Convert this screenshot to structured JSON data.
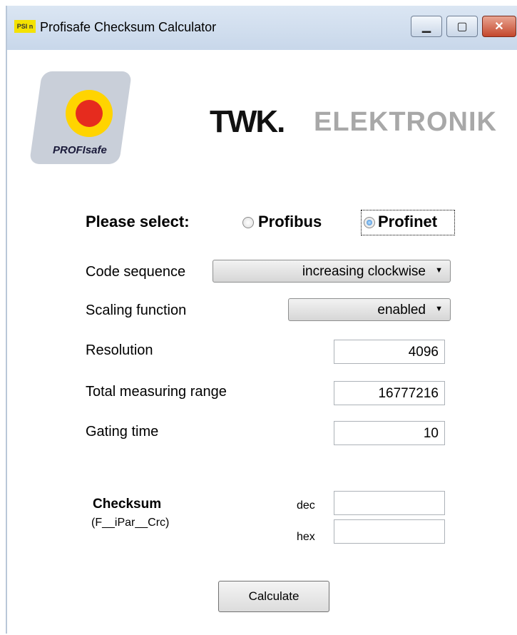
{
  "window": {
    "title": "Profisafe Checksum Calculator",
    "icon_text": "PSI n"
  },
  "logos": {
    "profisafe": "PROFIsafe",
    "twk": "TWK.",
    "elektronik": "ELEKTRONIK"
  },
  "protocol": {
    "label": "Please select:",
    "options": [
      "Profibus",
      "Profinet"
    ],
    "selected": "Profinet"
  },
  "form": {
    "code_sequence": {
      "label": "Code sequence",
      "value": "increasing clockwise"
    },
    "scaling_function": {
      "label": "Scaling function",
      "value": "enabled"
    },
    "resolution": {
      "label": "Resolution",
      "value": "4096"
    },
    "total_range": {
      "label": "Total measuring range",
      "value": "16777216"
    },
    "gating_time": {
      "label": "Gating time",
      "value": "10"
    }
  },
  "checksum": {
    "title": "Checksum",
    "subtitle": "(F__iPar__Crc)",
    "dec_label": "dec",
    "hex_label": "hex",
    "dec_value": "",
    "hex_value": ""
  },
  "calculate_label": "Calculate",
  "colors": {
    "titlebar": "#c8d7ea",
    "close_button": "#c4472c",
    "profisafe_yellow": "#ffd400",
    "profisafe_red": "#e62b1e"
  }
}
